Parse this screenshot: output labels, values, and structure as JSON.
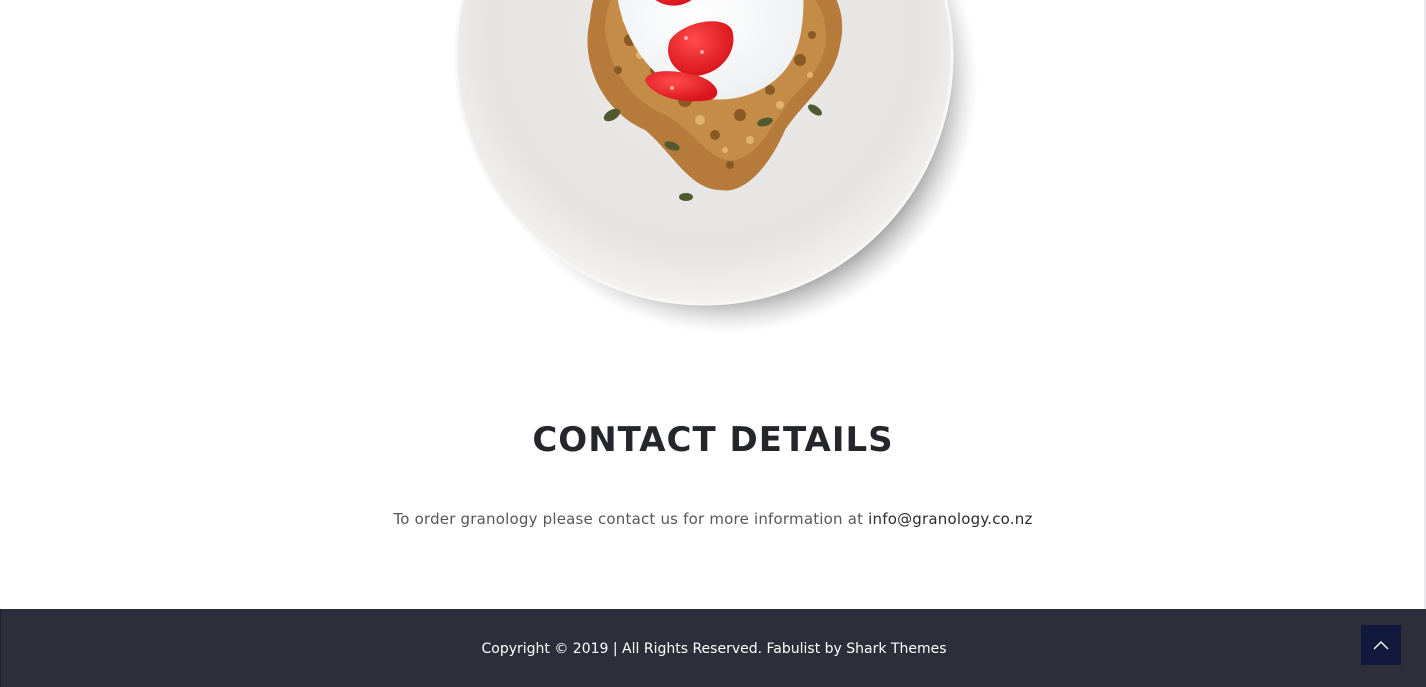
{
  "product_image": {
    "icon": "granola-plate-image",
    "alt": ""
  },
  "contact": {
    "title": "CONTACT DETAILS",
    "text": "To order granology please contact us for more information at",
    "email": "info@granology.co.nz"
  },
  "footer": {
    "copyright": "Copyright © 2019 | All Rights Reserved. Fabulist by Shark Themes",
    "back_to_top_icon": "chevron-up-icon"
  },
  "colors": {
    "footer_bg": "#2c2f3a",
    "back_to_top_bg": "#12193d",
    "heading": "#24262c",
    "body_text": "#55575d"
  }
}
